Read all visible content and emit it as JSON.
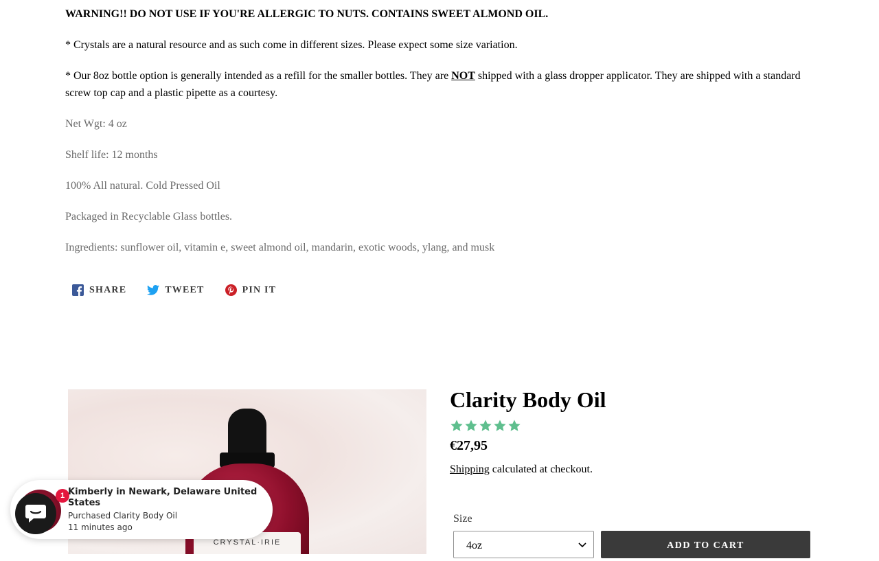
{
  "description": {
    "warning": "WARNING!! DO NOT USE IF YOU'RE ALLERGIC TO NUTS. CONTAINS SWEET ALMOND OIL.",
    "crystals_note": "* Crystals are a natural resource and as such come in different sizes. Please expect some size variation.",
    "bottle_note_before": "* Our 8oz bottle option is generally intended as a refill for the smaller bottles. They are ",
    "bottle_note_emphasis": "NOT",
    "bottle_note_after": " shipped with a glass dropper applicator. They are shipped with a standard screw top cap and a plastic pipette as a courtesy.",
    "net_weight": "Net Wgt: 4 oz",
    "shelf_life": "Shelf life: 12 months",
    "natural": "100% All natural. Cold Pressed Oil",
    "packaging": "Packaged in Recyclable Glass bottles.",
    "ingredients": "Ingredients: sunflower oil, vitamin e, sweet almond oil, mandarin, exotic woods, ylang, and musk"
  },
  "share": {
    "facebook_label": "SHARE",
    "twitter_label": "TWEET",
    "pinterest_label": "PIN IT"
  },
  "product": {
    "title": "Clarity Body Oil",
    "rating": 5,
    "rating_max": 5,
    "price": "€27,95",
    "shipping_link": "Shipping",
    "shipping_note": " calculated at checkout.",
    "image_label": "CRYSTAL·IRIE",
    "size_label": "Size",
    "size_selected": "4oz",
    "add_to_cart": "ADD TO CART"
  },
  "popup": {
    "badge_count": "1",
    "customer": "Kimberly in Newark, Delaware United States",
    "action": "Purchased Clarity Body Oil",
    "time_ago": "11 minutes ago"
  },
  "colors": {
    "star": "#5fbf8e",
    "button": "#3a3a3a",
    "badge": "#e4153d",
    "facebook": "#3b5998",
    "twitter": "#1da1f2",
    "pinterest": "#cb2027"
  }
}
